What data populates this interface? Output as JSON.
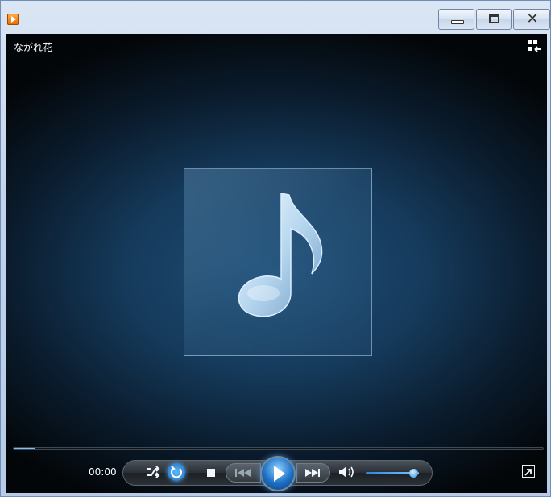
{
  "window": {
    "app_icon": "media-player-icon",
    "caption_buttons": [
      "minimize-icon",
      "maximize-icon",
      "close-icon"
    ]
  },
  "now_playing": {
    "title": "ながれ花",
    "album_art_icon": "music-note-icon",
    "view_switch_icon": "switch-to-library-icon"
  },
  "playback": {
    "time": "00:00",
    "seek_progress": 0.04,
    "volume_level": 0.9,
    "repeat_active": true,
    "controls": [
      "shuffle-icon",
      "repeat-icon",
      "stop-icon",
      "previous-icon",
      "play-icon",
      "next-icon",
      "mute-icon",
      "fullscreen-icon"
    ]
  },
  "colors": {
    "accent": "#2f86d6",
    "background_center": "#1f4f78",
    "background_edge": "#030608"
  }
}
